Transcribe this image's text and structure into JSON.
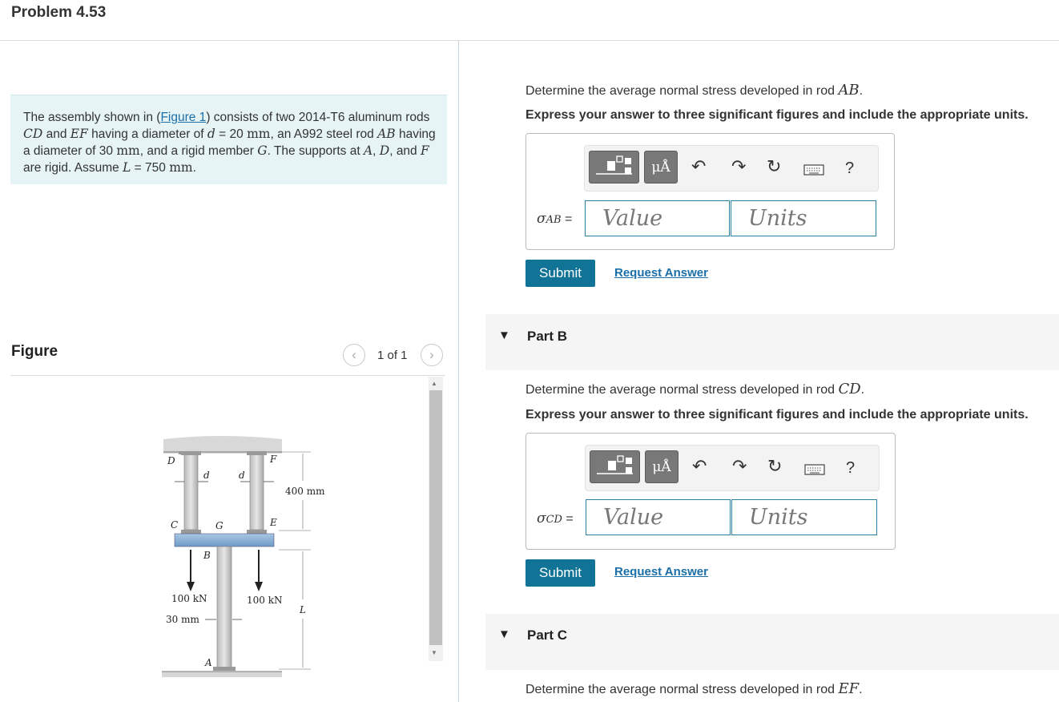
{
  "problem": {
    "title": "Problem 4.53"
  },
  "intro": {
    "t1": "The assembly shown in (",
    "figure_link": "Figure 1",
    "t2": ") consists of two 2014-T6 aluminum rods ",
    "cd": "CD",
    "t3": " and ",
    "ef": "EF",
    "t4": " having a diameter of ",
    "d": "d",
    "t5": " = 20 ",
    "mm": "mm",
    "t6": ", an A992 steel rod ",
    "ab": "AB",
    "t7": " having a diameter of 30 ",
    "mm2": "mm",
    "t8": ", and a rigid member ",
    "g": "G",
    "t9": ". The supports at ",
    "a": "A",
    "t10": ", ",
    "dd": "D",
    "t11": ", and ",
    "f": "F",
    "t12": " are rigid. Assume ",
    "l": "L",
    "t13": " = 750 ",
    "mm3": "mm",
    "t14": "."
  },
  "figure": {
    "title": "Figure",
    "counter": "1 of 1",
    "prev_icon": "chevron-left-icon",
    "next_icon": "chevron-right-icon",
    "labels": {
      "D": "D",
      "F": "F",
      "d1": "d",
      "d2": "d",
      "dim400": "400 mm",
      "C": "C",
      "G": "G",
      "E": "E",
      "B": "B",
      "load1": "100 kN",
      "load2": "100 kN",
      "L": "L",
      "dia30": "30 mm",
      "A": "A"
    }
  },
  "toolbar": {
    "template_icon": "template-icon",
    "units_icon": "units-icon",
    "units_glyph": "μÅ",
    "undo_icon": "undo-icon",
    "redo_icon": "redo-icon",
    "reset_icon": "reset-icon",
    "keyboard_icon": "keyboard-icon",
    "help_label": "?"
  },
  "part_a": {
    "q_text": "Determine the average normal stress developed in rod ",
    "q_var": "AB",
    "q_end": ".",
    "instructions": "Express your answer to three significant figures and include the appropriate units.",
    "sigma": "σ",
    "sub": "AB",
    "eq": " =",
    "value_placeholder": "Value",
    "units_placeholder": "Units",
    "submit_label": "Submit",
    "request_label": "Request Answer"
  },
  "part_b": {
    "label": "Part B",
    "q_text": "Determine the average normal stress developed in rod ",
    "q_var": "CD",
    "q_end": ".",
    "instructions": "Express your answer to three significant figures and include the appropriate units.",
    "sigma": "σ",
    "sub": "CD",
    "eq": " =",
    "value_placeholder": "Value",
    "units_placeholder": "Units",
    "submit_label": "Submit",
    "request_label": "Request Answer"
  },
  "part_c": {
    "label": "Part C",
    "q_text": "Determine the average normal stress developed in rod ",
    "q_var": "EF",
    "q_end": "."
  },
  "colors": {
    "submit": "#117396",
    "link": "#1b6fa8",
    "intro_bg": "#e6f4f6",
    "field_border": "#2c7ea3"
  }
}
